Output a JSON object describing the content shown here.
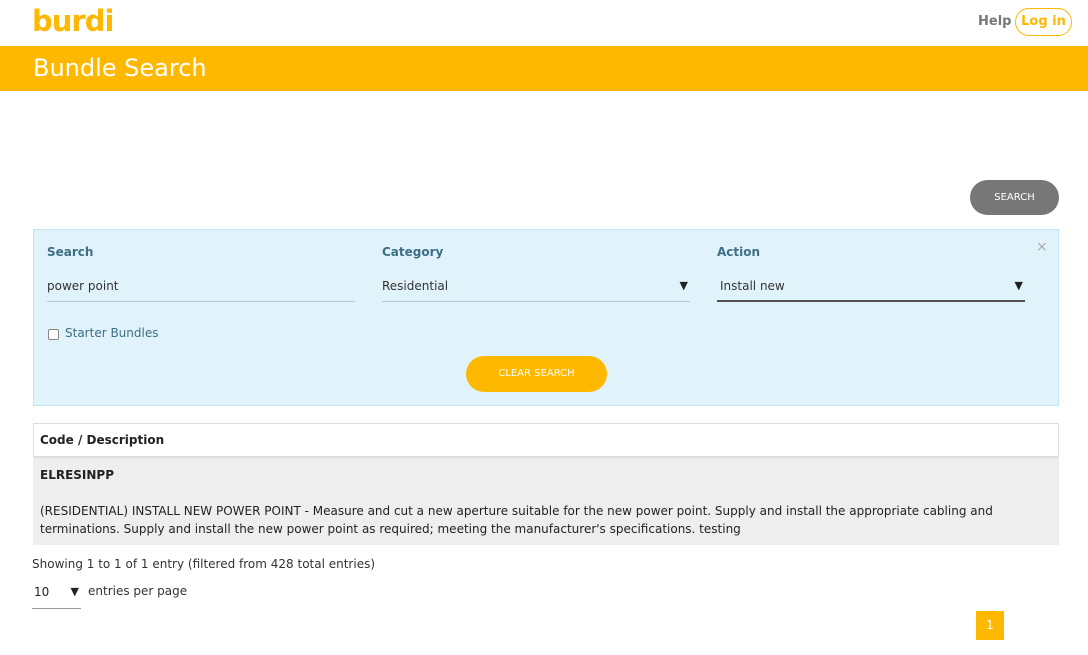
{
  "header": {
    "logo_text": "burdi",
    "help_label": "Help",
    "login_label": "Log in"
  },
  "banner": {
    "title": "Bundle Search"
  },
  "toolbar": {
    "search_toggle_label": "SEARCH"
  },
  "filters": {
    "close_symbol": "×",
    "search_label": "Search",
    "search_value": "power point",
    "category_label": "Category",
    "category_value": "Residential",
    "action_label": "Action",
    "action_value": "Install new",
    "starter_bundles_label": "Starter Bundles",
    "starter_bundles_checked": false,
    "clear_label": "CLEAR SEARCH"
  },
  "table": {
    "header": "Code / Description",
    "rows": [
      {
        "code": "ELRESINPP",
        "description": "(RESIDENTIAL) INSTALL NEW POWER POINT - Measure and cut a new aperture suitable for the new power point. Supply and install the appropriate cabling and terminations. Supply and install the new power point as required; meeting the manufacturer's specifications. testing"
      }
    ]
  },
  "footer": {
    "info": "Showing 1 to 1 of 1 entry (filtered from 428 total entries)",
    "page_size": "10",
    "per_page_label": "entries per page",
    "current_page": "1"
  },
  "colors": {
    "brand": "#ffb800",
    "panel": "#e1f3fa",
    "label": "#3d6f87"
  }
}
